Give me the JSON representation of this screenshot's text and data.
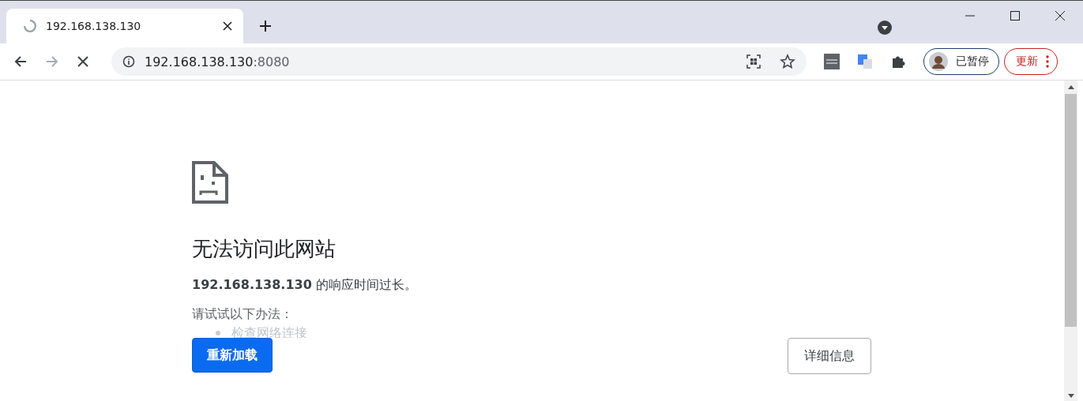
{
  "tab": {
    "title": "192.168.138.130",
    "selected": true
  },
  "address": {
    "host": "192.168.138.130",
    "port": ":8080"
  },
  "profile": {
    "label": "已暂停"
  },
  "update": {
    "label": "更新"
  },
  "error": {
    "title": "无法访问此网站",
    "message": "**192.168.138.130** 的响应时间过长。",
    "suggestions_heading": "请试试以下办法：",
    "suggestions": [
      "检查网络连接"
    ],
    "reload": "重新加载",
    "details": "详细信息"
  }
}
